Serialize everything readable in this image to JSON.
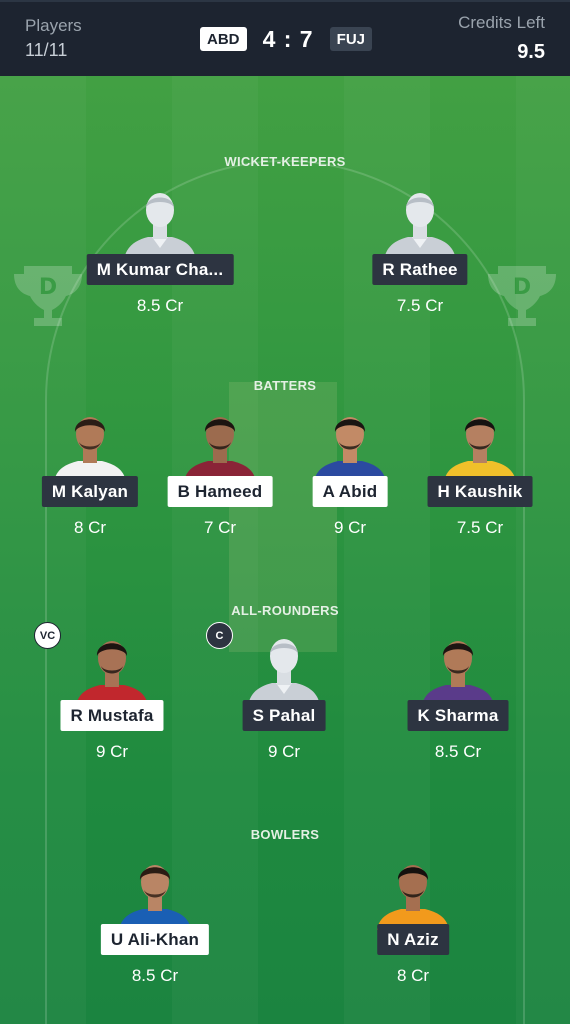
{
  "header": {
    "players_label": "Players",
    "players_value": "11/11",
    "team_left": "ABD",
    "score": "4 : 7",
    "team_right": "FUJ",
    "credits_label": "Credits Left",
    "credits_value": "9.5"
  },
  "sections": {
    "wicket_keepers": "WICKET-KEEPERS",
    "batters": "BATTERS",
    "all_rounders": "ALL-ROUNDERS",
    "bowlers": "BOWLERS"
  },
  "wicket_keepers": [
    {
      "name": "M Kumar Cha...",
      "credits": "8.5 Cr",
      "tag": "dark",
      "avatar": "placeholder-avatar"
    },
    {
      "name": "R Rathee",
      "credits": "7.5 Cr",
      "tag": "dark",
      "avatar": "placeholder-avatar"
    }
  ],
  "batters": [
    {
      "name": "M Kalyan",
      "credits": "8 Cr",
      "tag": "dark",
      "avatar": "player-photo"
    },
    {
      "name": "B Hameed",
      "credits": "7 Cr",
      "tag": "light",
      "avatar": "player-photo"
    },
    {
      "name": "A Abid",
      "credits": "9 Cr",
      "tag": "light",
      "avatar": "player-photo"
    },
    {
      "name": "H Kaushik",
      "credits": "7.5 Cr",
      "tag": "dark",
      "avatar": "player-photo"
    }
  ],
  "all_rounders": [
    {
      "name": "R Mustafa",
      "credits": "9 Cr",
      "tag": "light",
      "avatar": "player-photo",
      "badge": "VC"
    },
    {
      "name": "S Pahal",
      "credits": "9 Cr",
      "tag": "dark",
      "avatar": "placeholder-avatar",
      "badge": "C"
    },
    {
      "name": "K Sharma",
      "credits": "8.5 Cr",
      "tag": "dark",
      "avatar": "player-photo"
    }
  ],
  "bowlers": [
    {
      "name": "U Ali-Khan",
      "credits": "8.5 Cr",
      "tag": "light",
      "avatar": "player-photo"
    },
    {
      "name": "N Aziz",
      "credits": "8 Cr",
      "tag": "dark",
      "avatar": "player-photo"
    }
  ],
  "colors": {
    "header_bg": "#1d2430",
    "field_green": "#2f9640",
    "tag_dark": "#2d3441",
    "tag_light": "#ffffff"
  }
}
